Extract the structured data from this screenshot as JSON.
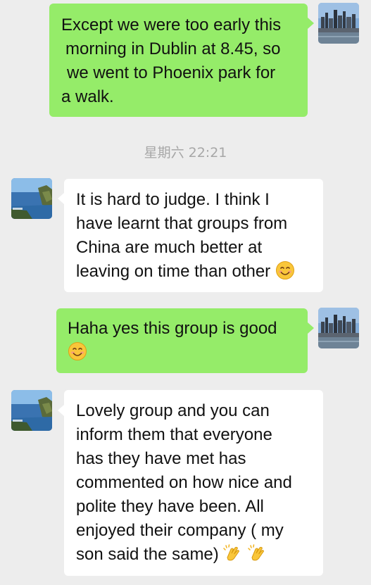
{
  "colors": {
    "background": "#ededed",
    "my_bubble": "#95ec69",
    "their_bubble": "#ffffff",
    "timestamp": "#a7a7a7"
  },
  "messages": [
    {
      "sender": "me",
      "avatar": "city-skyline-avatar",
      "lines": [
        "Except we were too early this",
        "morning in Dublin at 8.45, so",
        "we went to Phoenix park for",
        "a walk."
      ]
    },
    {
      "sender": "them",
      "avatar": "coastal-cliff-avatar",
      "lines": [
        "It is hard to judge. I think I",
        "have learnt that groups from",
        "China are much better at",
        "leaving on time than other"
      ],
      "emoji": "smiling-face-icon"
    },
    {
      "sender": "me",
      "avatar": "city-skyline-avatar",
      "lines": [
        "Haha yes this group is good",
        ""
      ],
      "emoji": "smiling-face-icon"
    },
    {
      "sender": "them",
      "avatar": "coastal-cliff-avatar",
      "lines": [
        "Lovely group and you can",
        "inform them that everyone",
        "has they have met has",
        "commented on how nice and",
        "polite they have been. All",
        "enjoyed their company ( my",
        "son said the same)"
      ],
      "emoji": "clapping-hands-icon"
    }
  ],
  "timestamp": "星期六 22:21"
}
